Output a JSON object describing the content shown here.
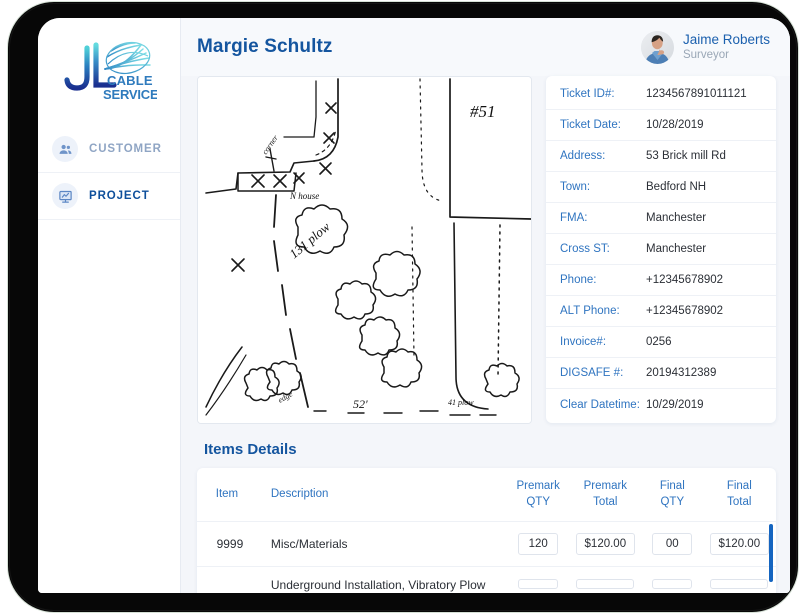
{
  "sidebar": {
    "logo": {
      "line1": "J",
      "line2": "L",
      "word1": "CABLE",
      "word2": "SERVICES",
      "alt": "JL Cable Services"
    },
    "items": [
      {
        "label": "CUSTOMER",
        "icon": "people-icon",
        "active": false
      },
      {
        "label": "PROJECT",
        "icon": "presentation-board-icon",
        "active": true
      }
    ]
  },
  "header": {
    "title": "Margie Schultz",
    "user": {
      "name": "Jaime Roberts",
      "role": "Surveyor",
      "avatar": "user-photo"
    }
  },
  "sketch": {
    "label": "site-sketch",
    "annotations": [
      "#51",
      "131 plow",
      "52'",
      "N house",
      "41 plow"
    ]
  },
  "details": {
    "rows": [
      {
        "label": "Ticket ID#:",
        "value": "1234567891011121"
      },
      {
        "label": "Ticket Date:",
        "value": "10/28/2019"
      },
      {
        "label": "Address:",
        "value": "53 Brick mill Rd"
      },
      {
        "label": "Town:",
        "value": "Bedford NH"
      },
      {
        "label": "FMA:",
        "value": "Manchester"
      },
      {
        "label": "Cross ST:",
        "value": "Manchester"
      },
      {
        "label": "Phone:",
        "value": "+12345678902"
      },
      {
        "label": "ALT Phone:",
        "value": "+12345678902"
      },
      {
        "label": "Invoice#:",
        "value": "0256"
      },
      {
        "label": "DIGSAFE #:",
        "value": "20194312389"
      },
      {
        "label": "Clear Datetime:",
        "value": "10/29/2019"
      }
    ]
  },
  "items_details": {
    "title": "Items Details",
    "columns": [
      {
        "label": "Item"
      },
      {
        "label": "Description"
      },
      {
        "label": "Premark\nQTY",
        "l1": "Premark",
        "l2": "QTY"
      },
      {
        "label": "Premark\nTotal",
        "l1": "Premark",
        "l2": "Total"
      },
      {
        "label": "Final\nQTY",
        "l1": "Final",
        "l2": "QTY"
      },
      {
        "label": "Final\nTotal",
        "l1": "Final",
        "l2": "Total"
      }
    ],
    "rows": [
      {
        "item": "9999",
        "description": "Misc/Materials",
        "premark_qty": "120",
        "premark_total": "$120.00",
        "final_qty": "00",
        "final_total": "$120.00"
      },
      {
        "item": "",
        "description": "Underground Installation, Vibratory Plow",
        "premark_qty": "",
        "premark_total": "",
        "final_qty": "",
        "final_total": ""
      }
    ]
  },
  "colors": {
    "accent": "#14559f",
    "label_blue": "#2f74c0",
    "scrollbar": "#1565c0",
    "bg": "#f4f6fa"
  }
}
